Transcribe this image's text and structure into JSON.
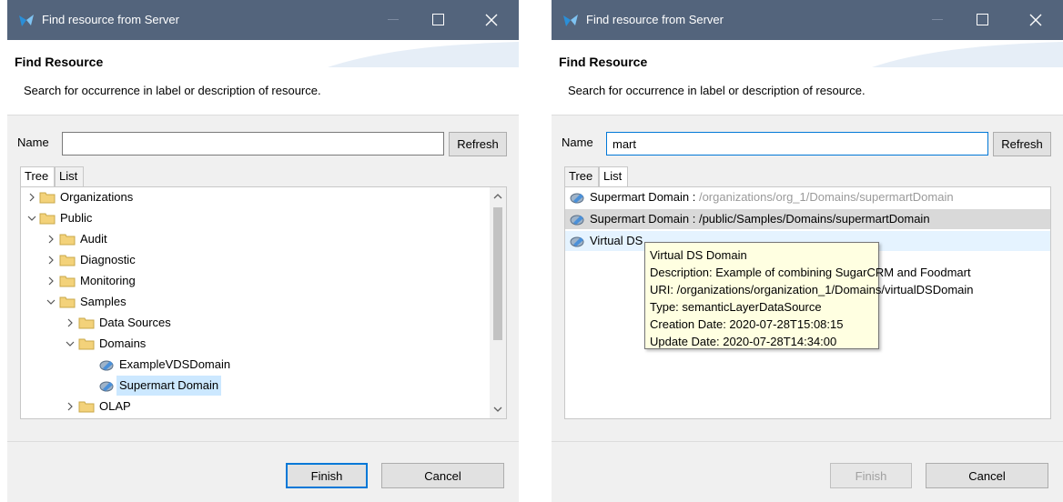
{
  "left": {
    "title": "Find resource from Server",
    "header_title": "Find Resource",
    "header_desc": "Search for occurrence in label or description of resource.",
    "name_label": "Name",
    "name_value": "",
    "refresh_label": "Refresh",
    "tabs": [
      "Tree",
      "List"
    ],
    "active_tab": "Tree",
    "tree": [
      {
        "label": "Organizations",
        "expanded": false,
        "level": 0,
        "type": "folder"
      },
      {
        "label": "Public",
        "expanded": true,
        "level": 0,
        "type": "folder"
      },
      {
        "label": "Audit",
        "expanded": false,
        "level": 1,
        "type": "folder"
      },
      {
        "label": "Diagnostic",
        "expanded": false,
        "level": 1,
        "type": "folder"
      },
      {
        "label": "Monitoring",
        "expanded": false,
        "level": 1,
        "type": "folder"
      },
      {
        "label": "Samples",
        "expanded": true,
        "level": 1,
        "type": "folder"
      },
      {
        "label": "Data Sources",
        "expanded": false,
        "level": 2,
        "type": "folder"
      },
      {
        "label": "Domains",
        "expanded": true,
        "level": 2,
        "type": "folder"
      },
      {
        "label": "ExampleVDSDomain",
        "level": 3,
        "type": "resource"
      },
      {
        "label": "Supermart Domain",
        "level": 3,
        "type": "resource",
        "selected": true
      },
      {
        "label": "OLAP",
        "expanded": false,
        "level": 2,
        "type": "folder"
      }
    ],
    "finish_label": "Finish",
    "cancel_label": "Cancel"
  },
  "right": {
    "title": "Find resource from Server",
    "header_title": "Find Resource",
    "header_desc": "Search for occurrence in label or description of resource.",
    "name_label": "Name",
    "name_value": "mart",
    "refresh_label": "Refresh",
    "tabs": [
      "Tree",
      "List"
    ],
    "active_tab": "List",
    "list": [
      {
        "name": "Supermart Domain",
        "sep": " : ",
        "path": "/organizations/org_1/Domains/supermartDomain"
      },
      {
        "name": "Supermart Domain",
        "sep": " : ",
        "path": "/public/Samples/Domains/supermartDomain"
      },
      {
        "name": "Virtual DS Domain",
        "sep": "",
        "path": ""
      }
    ],
    "list_row3_visible": "Virtual DS",
    "tooltip": [
      "Virtual DS Domain",
      "Description: Example of combining SugarCRM and Foodmart",
      "URI: /organizations/organization_1/Domains/virtualDSDomain",
      "Type: semanticLayerDataSource",
      "Creation Date: 2020-07-28T15:08:15",
      "Update Date: 2020-07-28T14:34:00"
    ],
    "finish_label": "Finish",
    "cancel_label": "Cancel"
  },
  "colors": {
    "titlebar": "#53647c",
    "accent": "#0078d7",
    "selection": "#cce8ff",
    "tooltip_bg": "#ffffe1",
    "folder": "#f3d27a"
  }
}
